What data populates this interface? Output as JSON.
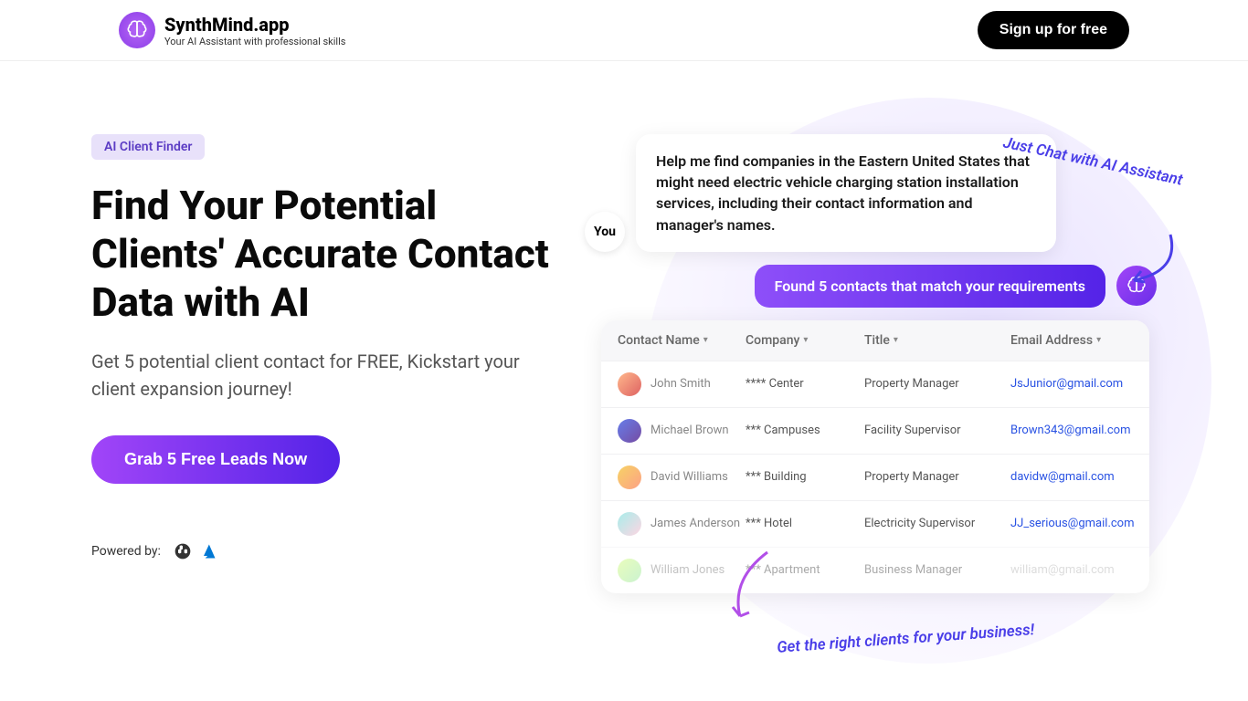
{
  "header": {
    "logo_title": "SynthMind.app",
    "logo_subtitle": "Your AI Assistant with professional skills",
    "signup_label": "Sign up for free"
  },
  "hero": {
    "badge": "AI Client Finder",
    "heading": "Find Your Potential Clients' Accurate Contact Data with AI",
    "subtext": "Get 5 potential client contact for FREE, Kickstart your client expansion journey!",
    "cta_label": "Grab 5 Free Leads Now",
    "powered_label": "Powered by:"
  },
  "demo": {
    "annotation_top": "Just Chat with AI Assistant",
    "annotation_bottom": "Get the right clients for your business!",
    "you_label": "You",
    "user_message": "Help me find companies in the Eastern United States that might need electric vehicle charging station installation services, including their contact information and manager's names.",
    "ai_response": "Found 5 contacts that match your requirements",
    "columns": {
      "name": "Contact Name",
      "company": "Company",
      "title": "Title",
      "email": "Email Address"
    },
    "rows": [
      {
        "name": "John Smith",
        "company": "**** Center",
        "title": "Property Manager",
        "email": "JsJunior@gmail.com"
      },
      {
        "name": "Michael Brown",
        "company": "*** Campuses",
        "title": "Facility Supervisor",
        "email": "Brown343@gmail.com"
      },
      {
        "name": "David Williams",
        "company": "*** Building",
        "title": "Property Manager",
        "email": "davidw@gmail.com"
      },
      {
        "name": "James Anderson",
        "company": "*** Hotel",
        "title": "Electricity Supervisor",
        "email": "JJ_serious@gmail.com"
      },
      {
        "name": "William Jones",
        "company": "*** Apartment",
        "title": "Business Manager",
        "email": "william@gmail.com"
      }
    ]
  }
}
